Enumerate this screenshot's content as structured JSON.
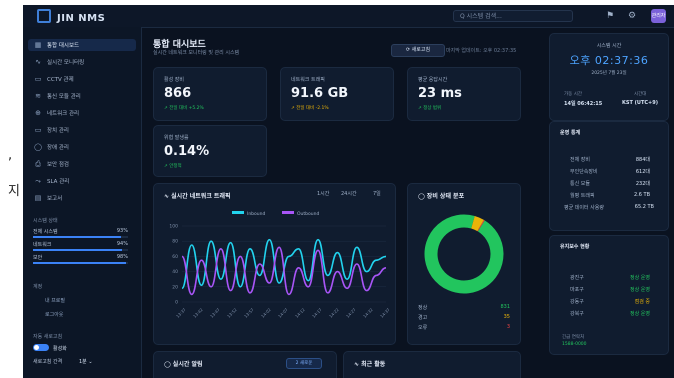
{
  "page_cut_text": [
    ",",
    "지"
  ],
  "app": {
    "name": "JIN NMS",
    "search_placeholder": "Q 시스템 검색...",
    "avatar": "관리자"
  },
  "sidebar": {
    "items": [
      {
        "label": "통합 대시보드",
        "icon": "▦",
        "active": true
      },
      {
        "label": "실시간 모니터링",
        "icon": "∿"
      },
      {
        "label": "CCTV 관제",
        "icon": "▭"
      },
      {
        "label": "통신 모듈 관리",
        "icon": "≋"
      },
      {
        "label": "네트워크 관리",
        "icon": "⊕"
      },
      {
        "label": "장치 관리",
        "icon": "▭"
      },
      {
        "label": "장애 관리",
        "icon": "◯"
      },
      {
        "label": "보안 점검",
        "icon": "⎙"
      },
      {
        "label": "SLA 관리",
        "icon": "⤳"
      },
      {
        "label": "보고서",
        "icon": "▤"
      }
    ],
    "resource_title": "시스템 상태",
    "resources": [
      {
        "label": "전체 시스템",
        "value": "93%",
        "fill": 0.93
      },
      {
        "label": "네트워크",
        "value": "94%",
        "fill": 0.94
      },
      {
        "label": "보안",
        "value": "98%",
        "fill": 0.98
      }
    ],
    "settings_title": "계정",
    "settings_items": [
      "내 프로필",
      "로그아웃"
    ],
    "auto_refresh_title": "자동 새로고침",
    "auto_refresh_state": "활성화",
    "refresh_interval_label": "새로고침 간격",
    "refresh_interval_value": "1분"
  },
  "main": {
    "title": "통합 대시보드",
    "subtitle": "실시간 네트워크 모니터링 및 관리 시스템",
    "refresh_label": "⟳ 새로고침",
    "last_update": "마지막 업데이트: 오후 02:37:35",
    "kpis": [
      {
        "label": "활성 장비",
        "value": "866",
        "trend": "↗ 전일 대비 +5.2%",
        "tone": "ok"
      },
      {
        "label": "네트워크 트래픽",
        "value": "91.6 GB",
        "trend": "↗ 전일 대비 -2.1%",
        "tone": "warn"
      },
      {
        "label": "평균 응답시간",
        "value": "23 ms",
        "trend": "↗ 정상 범위",
        "tone": "ok"
      },
      {
        "label": "위협 발생률",
        "value": "0.14%",
        "trend": "↗ 안정적",
        "tone": "ok"
      }
    ],
    "traffic": {
      "title": "∿ 실시간 네트워크 트래픽",
      "ranges": [
        "1시간",
        "24시간",
        "7일"
      ],
      "legend": [
        "Inbound",
        "Outbound"
      ]
    },
    "status": {
      "title": "◯ 장비 상태 분포",
      "rows": [
        {
          "label": "정상",
          "value": "831"
        },
        {
          "label": "경고",
          "value": "35"
        },
        {
          "label": "오류",
          "value": "3"
        }
      ]
    },
    "alerts_title": "◯ 실시간 알림",
    "alerts_badge": "2 새로운",
    "activity_title": "∿ 최근 활동"
  },
  "right": {
    "clock_title": "시스템 시간",
    "clock_value": "오후 02:37:36",
    "clock_date": "2025년 7월 23일",
    "uptime_label": "가동 시간",
    "uptime_value": "14일 06:42:15",
    "timezone_label": "시간대",
    "timezone_value": "KST (UTC+9)",
    "ops_title": "운영 통계",
    "ops": [
      {
        "label": "전체 장비",
        "value": "884대"
      },
      {
        "label": "무인단속장비",
        "value": "612대"
      },
      {
        "label": "통신 모듈",
        "value": "232대"
      },
      {
        "label": "월평 트래픽",
        "value": "2.6 TB"
      },
      {
        "label": "평균 데이터 사용량",
        "value": "65.2 TB"
      }
    ],
    "maint_title": "유지보수 현황",
    "maint": [
      {
        "label": "광진구",
        "value": "정상 운영",
        "tone": "ok"
      },
      {
        "label": "마포구",
        "value": "정상 운영",
        "tone": "ok"
      },
      {
        "label": "강동구",
        "value": "점검 중",
        "tone": "mid"
      },
      {
        "label": "강북구",
        "value": "정상 운영",
        "tone": "ok"
      }
    ],
    "contact_label": "긴급 연락처",
    "contact_value": "1588-0000"
  },
  "chart_data": {
    "type": "line",
    "title": "실시간 네트워크 트래픽",
    "xlabel": "",
    "ylabel": "",
    "ylim": [
      0,
      100
    ],
    "y_ticks": [
      100,
      80,
      60,
      40,
      20,
      0
    ],
    "categories": [
      "13:37",
      "13:42",
      "13:47",
      "13:52",
      "13:57",
      "14:02",
      "14:07",
      "14:12",
      "14:17",
      "14:22",
      "14:27",
      "14:32",
      "14:37"
    ],
    "series": [
      {
        "name": "Inbound",
        "color": "#22d3ee",
        "values": [
          18,
          75,
          22,
          80,
          30,
          78,
          20,
          70,
          35,
          82,
          25,
          60,
          70,
          28,
          82,
          35,
          65,
          30,
          72,
          40,
          55,
          60
        ]
      },
      {
        "name": "Outbound",
        "color": "#a855f7",
        "values": [
          60,
          10,
          55,
          20,
          70,
          15,
          60,
          12,
          50,
          25,
          72,
          10,
          45,
          20,
          68,
          12,
          40,
          18,
          50,
          15,
          35,
          45
        ]
      }
    ],
    "legend_position": "top",
    "donut": {
      "type": "pie",
      "slices": [
        {
          "name": "정상",
          "value": 831,
          "color": "#22c55e"
        },
        {
          "name": "경고",
          "value": 35,
          "color": "#eab308"
        },
        {
          "name": "오류",
          "value": 3,
          "color": "#ef4444"
        }
      ]
    }
  }
}
